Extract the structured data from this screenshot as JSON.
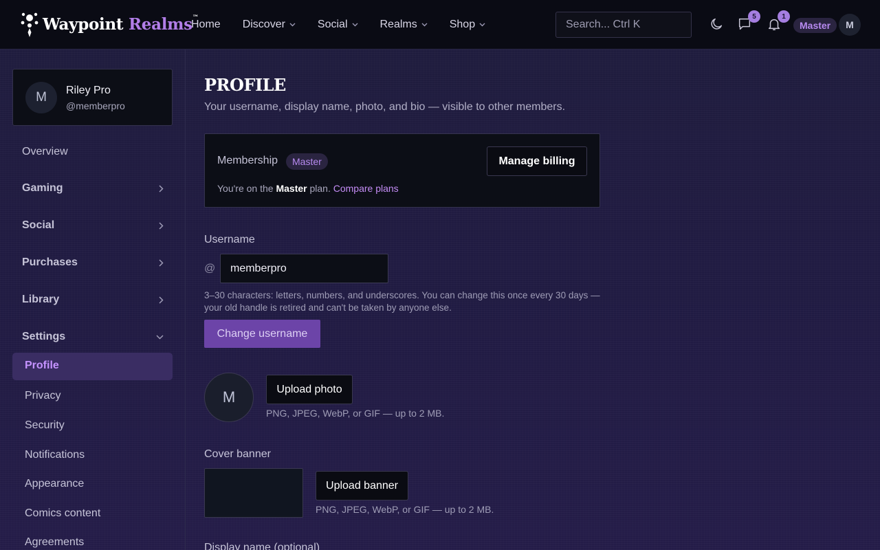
{
  "brand": {
    "name_part1": "Waypoint",
    "name_part2": "Realms",
    "tm": "™"
  },
  "nav": [
    {
      "label": "Home",
      "has_dropdown": false
    },
    {
      "label": "Discover",
      "has_dropdown": true
    },
    {
      "label": "Social",
      "has_dropdown": true
    },
    {
      "label": "Realms",
      "has_dropdown": true
    },
    {
      "label": "Shop",
      "has_dropdown": true
    }
  ],
  "search": {
    "placeholder": "Search... Ctrl K"
  },
  "header": {
    "messages_count": "5",
    "notifications_count": "1",
    "tier": "Master",
    "avatar_initial": "M"
  },
  "sidebar": {
    "user": {
      "initial": "M",
      "name": "Riley Pro",
      "handle": "@memberpro"
    },
    "overview": "Overview",
    "groups": [
      "Gaming",
      "Social",
      "Purchases",
      "Library",
      "Settings"
    ],
    "settings_items": [
      "Profile",
      "Privacy",
      "Security",
      "Notifications",
      "Appearance",
      "Comics content",
      "Agreements"
    ],
    "active_item": "Profile"
  },
  "main": {
    "title": "PROFILE",
    "subtitle": "Your username, display name, photo, and bio — visible to other members.",
    "membership": {
      "label": "Membership",
      "tier": "Master",
      "manage_button": "Manage billing",
      "line_prefix": "You're on the",
      "line_plan": "Master",
      "line_suffix": "plan.",
      "compare_link": "Compare plans"
    },
    "username": {
      "label": "Username",
      "at": "@",
      "value": "memberpro",
      "help": "3–30 characters: letters, numbers, and underscores. You can change this once every 30 days — your old handle is retired and can't be taken by anyone else.",
      "button": "Change username"
    },
    "photo": {
      "initial": "M",
      "button": "Upload photo",
      "hint": "PNG, JPEG, WebP, or GIF — up to 2 MB."
    },
    "banner": {
      "label": "Cover banner",
      "button": "Upload banner",
      "hint": "PNG, JPEG, WebP, or GIF — up to 2 MB."
    },
    "display_name_label": "Display name (optional)"
  }
}
